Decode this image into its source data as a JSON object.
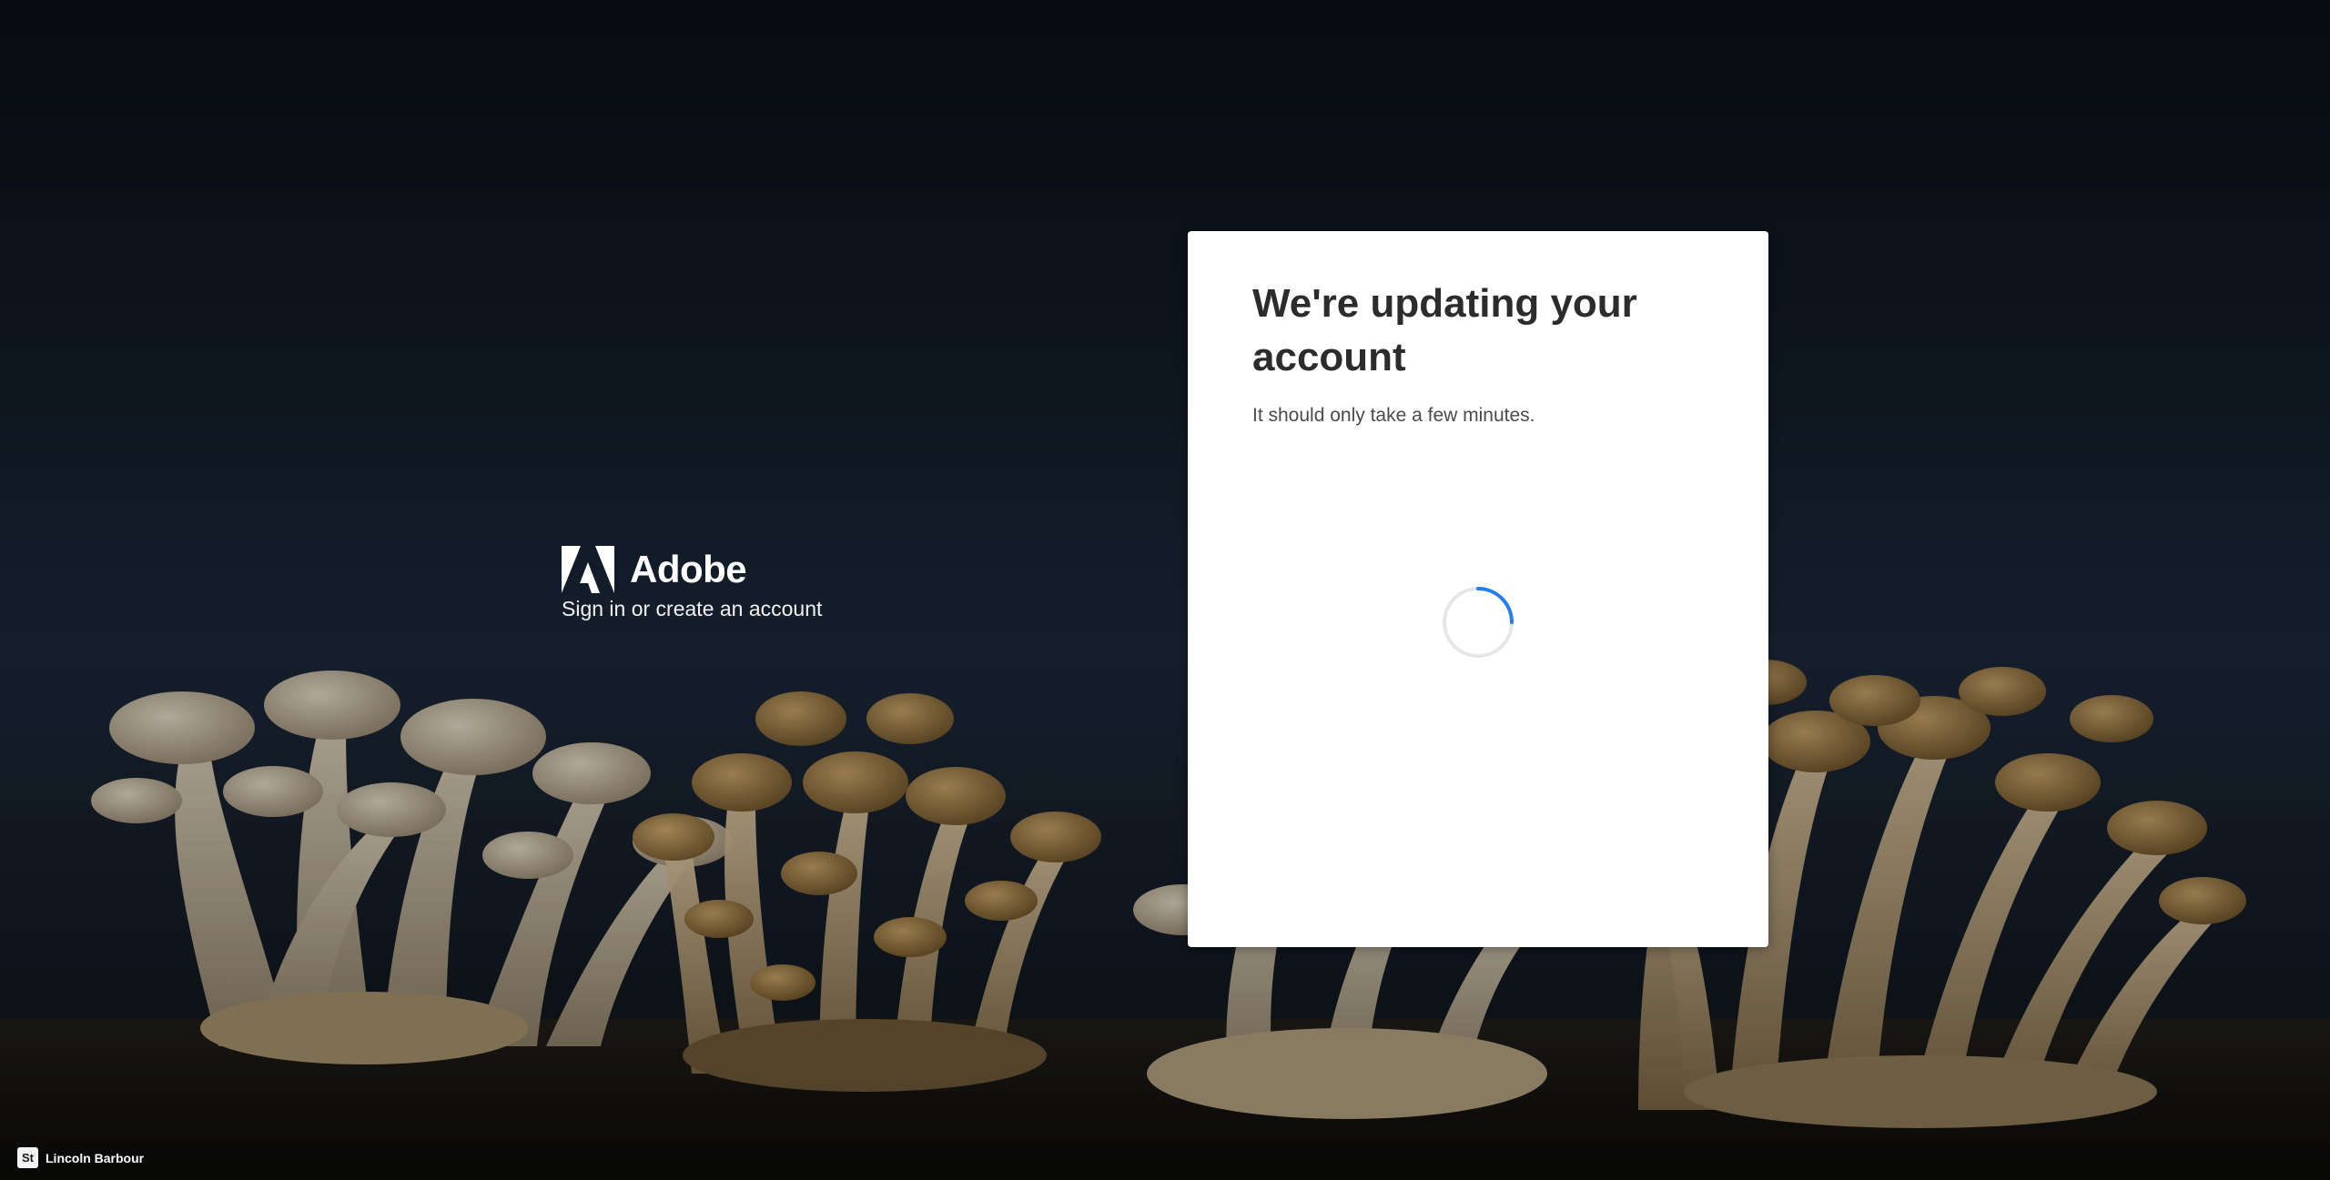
{
  "brand": {
    "name": "Adobe",
    "tagline": "Sign in or create an account",
    "logo_color": "#ffffff"
  },
  "card": {
    "title": "We're updating your account",
    "subtitle": "It should only take a few minutes.",
    "spinner_color": "#2680eb",
    "spinner_track_color": "#e6e6e6"
  },
  "background": {
    "image_subject": "mushrooms",
    "credit_badge": "St",
    "credit_name": "Lincoln Barbour"
  },
  "colors": {
    "card_bg": "#ffffff",
    "title_text": "#2c2c2c",
    "body_text": "#4b4b4b",
    "page_bg": "#111a25"
  }
}
